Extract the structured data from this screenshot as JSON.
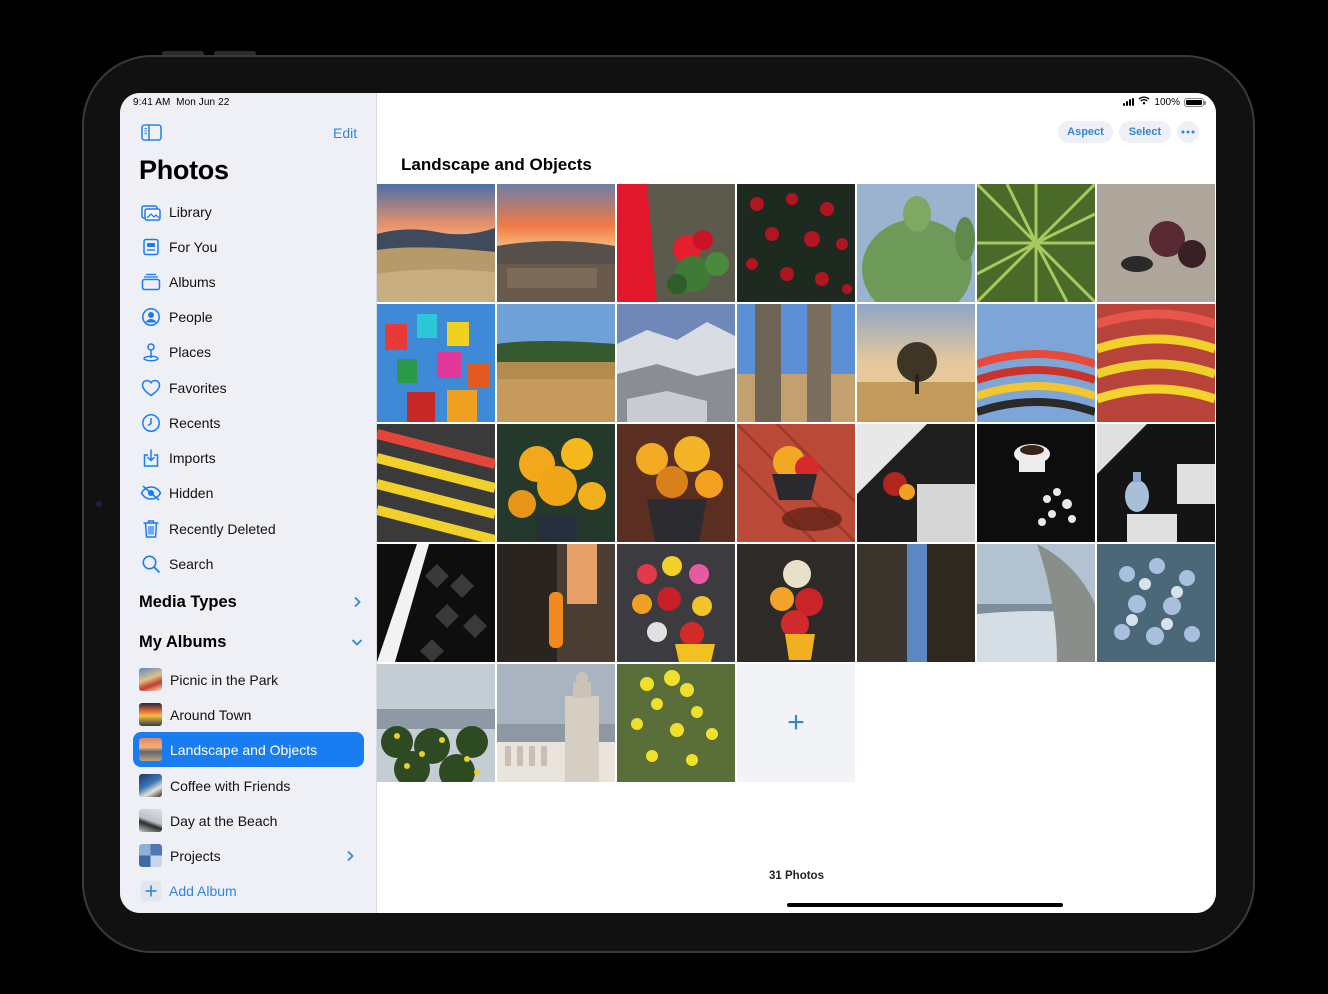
{
  "status_bar": {
    "time": "9:41 AM",
    "date": "Mon Jun 22",
    "battery": "100%"
  },
  "sidebar": {
    "edit_label": "Edit",
    "title": "Photos",
    "items": [
      {
        "label": "Library",
        "icon": "library-icon"
      },
      {
        "label": "For You",
        "icon": "for-you-icon"
      },
      {
        "label": "Albums",
        "icon": "albums-icon"
      },
      {
        "label": "People",
        "icon": "people-icon"
      },
      {
        "label": "Places",
        "icon": "places-icon"
      },
      {
        "label": "Favorites",
        "icon": "heart-icon"
      },
      {
        "label": "Recents",
        "icon": "clock-icon"
      },
      {
        "label": "Imports",
        "icon": "import-icon"
      },
      {
        "label": "Hidden",
        "icon": "eye-slash-icon"
      },
      {
        "label": "Recently Deleted",
        "icon": "trash-icon"
      },
      {
        "label": "Search",
        "icon": "search-icon"
      }
    ],
    "media_types_label": "Media Types",
    "my_albums_label": "My Albums",
    "albums": [
      {
        "label": "Picnic in the Park",
        "active": false
      },
      {
        "label": "Around Town",
        "active": false
      },
      {
        "label": "Landscape and Objects",
        "active": true
      },
      {
        "label": "Coffee with Friends",
        "active": false
      },
      {
        "label": "Day at the Beach",
        "active": false
      },
      {
        "label": "Projects",
        "active": false
      }
    ],
    "add_album_label": "Add Album"
  },
  "toolbar": {
    "aspect_label": "Aspect",
    "select_label": "Select"
  },
  "main": {
    "title": "Landscape and Objects",
    "photo_count": "31 Photos",
    "add_label": "+"
  },
  "colors": {
    "accent": "#1a7cf1",
    "link": "#2f86d8",
    "sidebar_bg": "#eef0f6"
  }
}
